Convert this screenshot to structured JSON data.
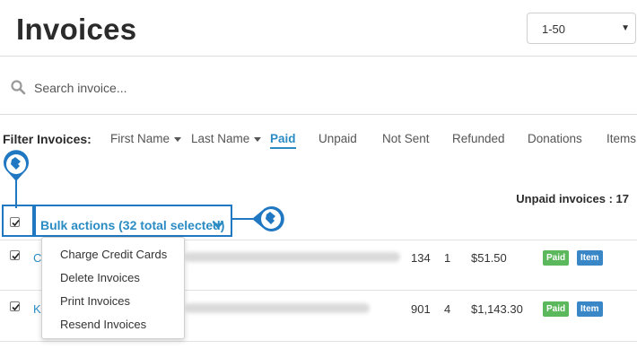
{
  "page": {
    "title": "Invoices"
  },
  "range_select": {
    "value": "1-50"
  },
  "search": {
    "placeholder": "Search invoice..."
  },
  "filters": {
    "label": "Filter Invoices:",
    "items": [
      {
        "label": "First Name",
        "dropdown": true
      },
      {
        "label": "Last Name",
        "dropdown": true
      },
      {
        "label": "Paid",
        "active": true
      },
      {
        "label": "Unpaid"
      },
      {
        "label": "Not Sent"
      },
      {
        "label": "Refunded"
      },
      {
        "label": "Donations"
      },
      {
        "label": "Items"
      }
    ]
  },
  "summary": {
    "unpaid_count": "Unpaid invoices : 17"
  },
  "bulk": {
    "label": "Bulk actions (32 total selected)"
  },
  "bulk_menu": {
    "items": [
      "Charge Credit Cards",
      "Delete Invoices",
      "Print Invoices",
      "Resend Invoices"
    ]
  },
  "rows": [
    {
      "name": "C",
      "number": "134",
      "qty": "1",
      "amount": "$51.50",
      "status": "Paid",
      "type": "Item",
      "checked": true
    },
    {
      "name": "K",
      "number": "901",
      "qty": "4",
      "amount": "$1,143.30",
      "status": "Paid",
      "type": "Item",
      "checked": true
    }
  ],
  "colors": {
    "accent": "#2b8cc4",
    "highlight": "#1f78c1",
    "paid": "#5cb85c",
    "item": "#3a87c8"
  },
  "icons": [
    "search-icon",
    "chevron-down-icon",
    "hand-pointer-icon"
  ]
}
